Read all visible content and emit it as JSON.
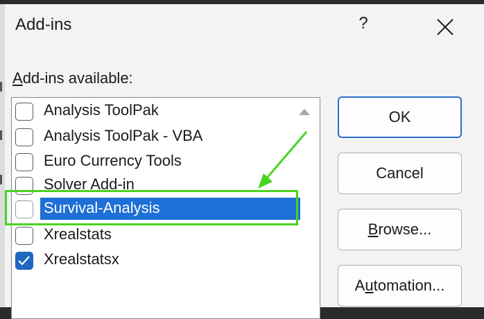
{
  "dialog": {
    "title": "Add-ins",
    "help_label": "?",
    "list_label_prefix": "A",
    "list_label_rest": "dd-ins available:"
  },
  "addins": [
    {
      "label": "Analysis ToolPak",
      "checked": false,
      "selected": false
    },
    {
      "label": "Analysis ToolPak - VBA",
      "checked": false,
      "selected": false
    },
    {
      "label": "Euro Currency Tools",
      "checked": false,
      "selected": false
    },
    {
      "label": "Solver Add-in",
      "checked": false,
      "selected": false
    },
    {
      "label": "Survival-Analysis",
      "checked": false,
      "selected": true
    },
    {
      "label": "Xrealstats",
      "checked": false,
      "selected": false
    },
    {
      "label": "Xrealstatsx",
      "checked": true,
      "selected": false
    }
  ],
  "buttons": {
    "ok": "OK",
    "cancel": "Cancel",
    "browse_prefix": "B",
    "browse_rest": "rowse...",
    "automation_prefix": "A",
    "automation_mid": "u",
    "automation_rest": "tomation..."
  },
  "colors": {
    "selection": "#1e6fd6",
    "checked": "#1f67c0",
    "highlight_annotation": "#4ad321",
    "default_button_border": "#2a6fc9"
  },
  "icons": [
    "close-icon",
    "scroll-up-arrow-icon",
    "checkmark-icon",
    "annotation-arrow-icon"
  ]
}
